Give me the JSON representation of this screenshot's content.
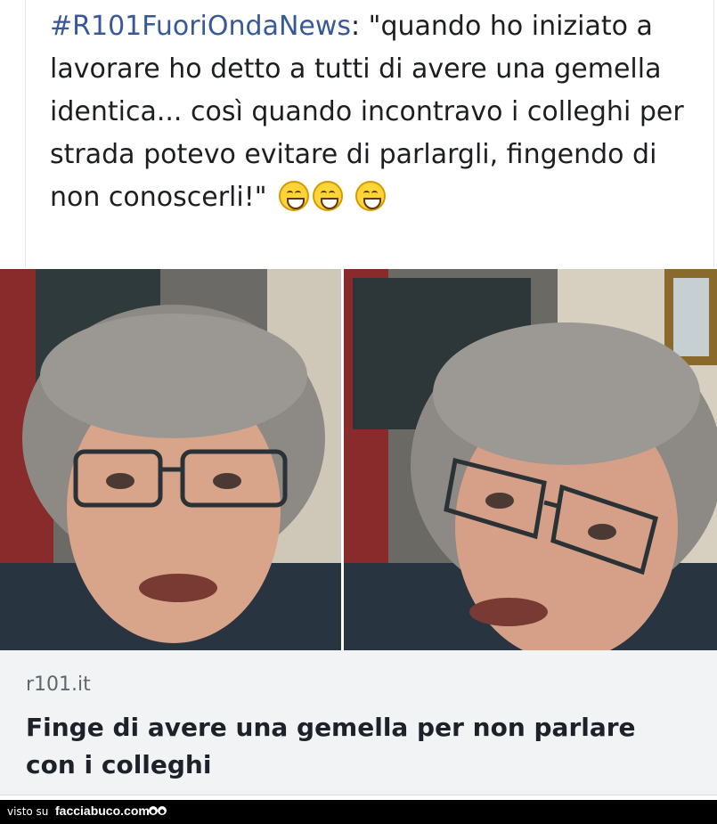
{
  "post": {
    "hashtag": "#R101FuoriOndaNews",
    "text": ": \"quando ho iniziato a lavorare ho detto a tutti di avere una gemella identica... così quando incontravo i colleghi per strada potevo evitare di parlargli, fingendo di non conoscerli!\"",
    "emojis": [
      "grinning-face-icon",
      "grinning-face-icon",
      "grinning-face-icon"
    ]
  },
  "link_card": {
    "domain": "r101.it",
    "headline": "Finge di avere una gemella per non parlare con i colleghi"
  },
  "footer": {
    "seen_on": "visto su",
    "brand": "facciabuco.com"
  },
  "colors": {
    "hashtag": "#385898",
    "card_background": "#f2f3f5",
    "footer_background": "#000000"
  }
}
